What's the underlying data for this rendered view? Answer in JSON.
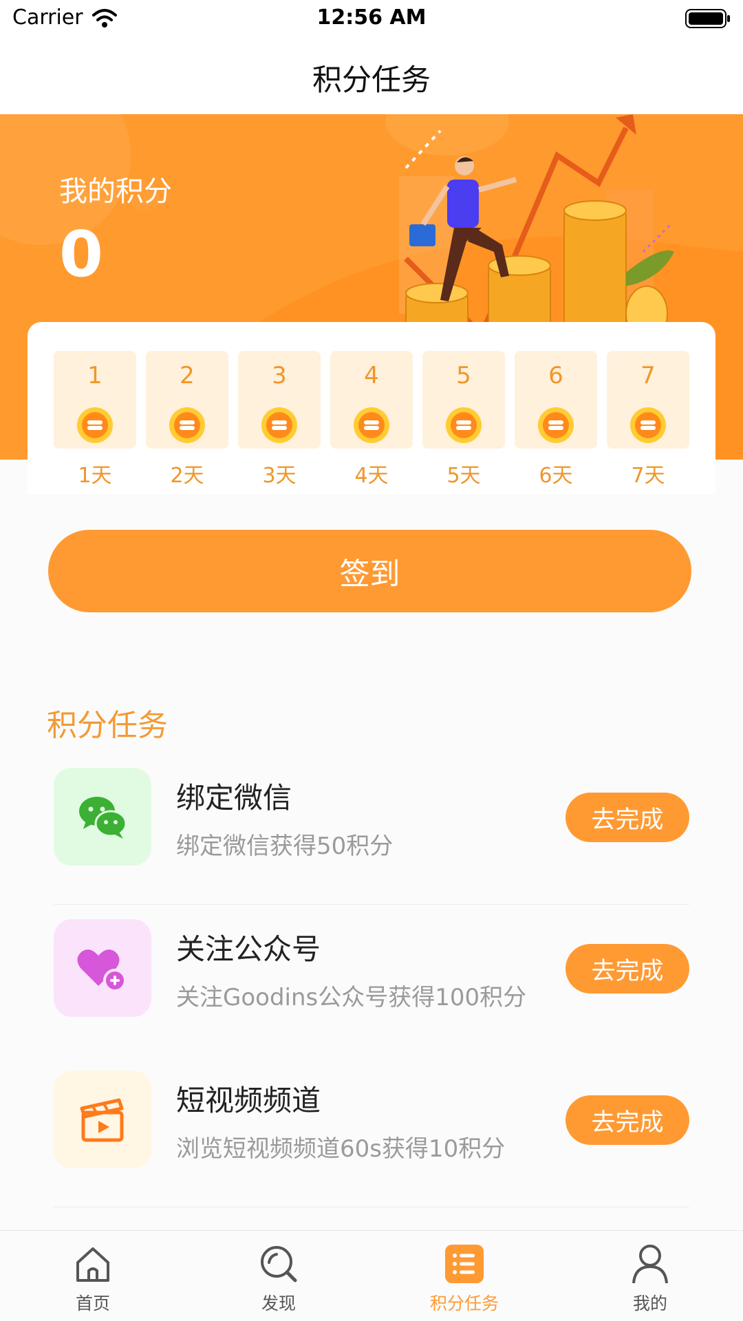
{
  "status_bar": {
    "carrier": "Carrier",
    "time": "12:56 AM"
  },
  "nav": {
    "title": "积分任务"
  },
  "hero": {
    "label": "我的积分",
    "points": "0"
  },
  "checkin": {
    "days": [
      {
        "num": "1",
        "label": "1天"
      },
      {
        "num": "2",
        "label": "2天"
      },
      {
        "num": "3",
        "label": "3天"
      },
      {
        "num": "4",
        "label": "4天"
      },
      {
        "num": "5",
        "label": "5天"
      },
      {
        "num": "6",
        "label": "6天"
      },
      {
        "num": "7",
        "label": "7天"
      }
    ],
    "button": "签到"
  },
  "tasks_section": {
    "title": "积分任务",
    "items": [
      {
        "icon": "wechat-icon",
        "title": "绑定微信",
        "desc": "绑定微信获得50积分",
        "button": "去完成",
        "bg": "#e0fbe2"
      },
      {
        "icon": "heart-plus-icon",
        "title": "关注公众号",
        "desc": "关注Goodins公众号获得100积分",
        "button": "去完成",
        "bg": "#fbe4fb"
      },
      {
        "icon": "clapperboard-icon",
        "title": "短视频频道",
        "desc": "浏览短视频频道60s获得10积分",
        "button": "去完成",
        "bg": "#fff6e4"
      }
    ]
  },
  "tab_bar": {
    "items": [
      {
        "label": "首页",
        "icon": "home-icon"
      },
      {
        "label": "发现",
        "icon": "discover-icon"
      },
      {
        "label": "积分任务",
        "icon": "task-list-icon",
        "active": true
      },
      {
        "label": "我的",
        "icon": "profile-icon"
      }
    ]
  },
  "colors": {
    "accent": "#ff9a33",
    "hero_bg": "#ff9a2e",
    "day_box": "#fff1dc"
  }
}
